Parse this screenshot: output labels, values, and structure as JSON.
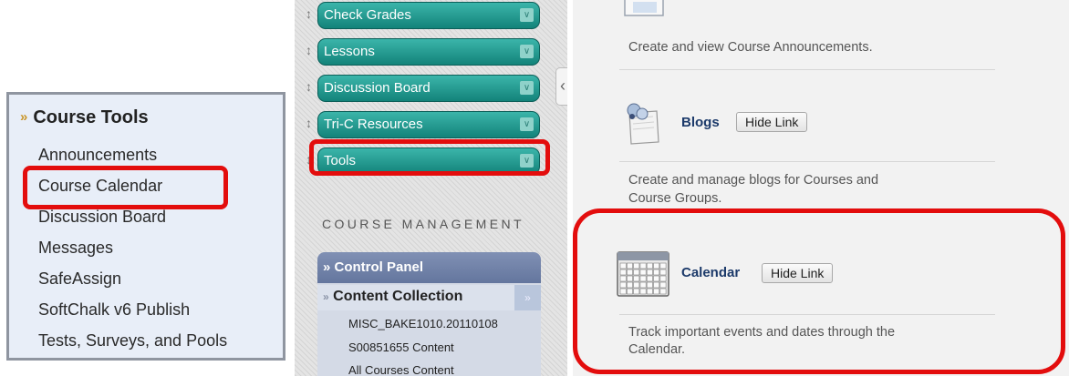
{
  "course_tools": {
    "title": "Course Tools",
    "items": [
      "Announcements",
      "Course Calendar",
      "Discussion Board",
      "Messages",
      "SafeAssign",
      "SoftChalk v6 Publish",
      "Tests, Surveys, and Pools"
    ]
  },
  "course_menu": {
    "items": [
      "Check Grades",
      "Lessons",
      "Discussion Board",
      "Tri-C Resources",
      "Tools"
    ]
  },
  "course_management": {
    "title": "COURSE MANAGEMENT",
    "control_panel": "Control Panel",
    "content_collection": "Content Collection",
    "content_items": [
      "MISC_BAKE1010.20110108",
      "S00851655 Content",
      "All Courses Content"
    ]
  },
  "tools": {
    "announcements_desc": "Create and view Course Announcements.",
    "blogs_title": "Blogs",
    "blogs_desc_1": "Create and manage blogs for Courses and",
    "blogs_desc_2": "Course Groups.",
    "calendar_title": "Calendar",
    "calendar_desc_1": "Track important events and dates through the",
    "calendar_desc_2": "Calendar.",
    "hide_link_label": "Hide Link"
  },
  "colors": {
    "highlight_red": "#e30d0d",
    "menu_teal": "#1f9a90",
    "panel_blue": "#e8eef8",
    "title_navy": "#1c3a6a"
  }
}
